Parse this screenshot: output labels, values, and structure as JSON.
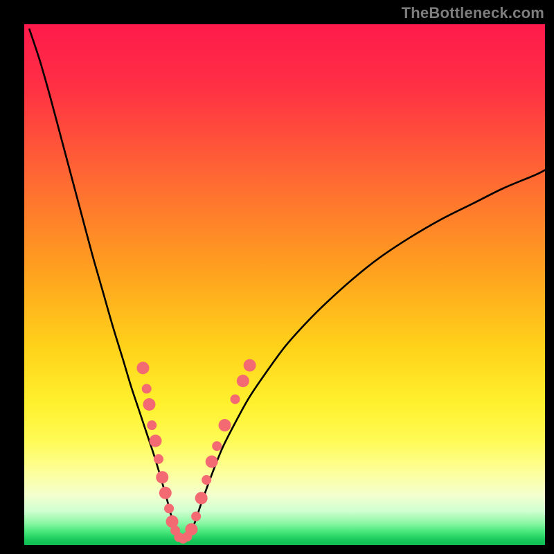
{
  "watermark": "TheBottleneck.com",
  "chart_data": {
    "type": "line",
    "title": "",
    "xlabel": "",
    "ylabel": "",
    "xlim": [
      0,
      100
    ],
    "ylim": [
      0,
      100
    ],
    "gradient_stops": [
      {
        "offset": 0.0,
        "color": "#ff1a4b"
      },
      {
        "offset": 0.12,
        "color": "#ff3044"
      },
      {
        "offset": 0.3,
        "color": "#ff6a32"
      },
      {
        "offset": 0.48,
        "color": "#ffa31e"
      },
      {
        "offset": 0.62,
        "color": "#ffd21a"
      },
      {
        "offset": 0.73,
        "color": "#fff12e"
      },
      {
        "offset": 0.8,
        "color": "#fffb55"
      },
      {
        "offset": 0.86,
        "color": "#fdff9a"
      },
      {
        "offset": 0.905,
        "color": "#f3ffcf"
      },
      {
        "offset": 0.935,
        "color": "#cfffd0"
      },
      {
        "offset": 0.958,
        "color": "#8bf7a4"
      },
      {
        "offset": 0.975,
        "color": "#46e77a"
      },
      {
        "offset": 0.99,
        "color": "#19c95b"
      },
      {
        "offset": 1.0,
        "color": "#0fbe52"
      }
    ],
    "series": [
      {
        "name": "bottleneck-curve",
        "x": [
          1,
          3,
          5,
          7,
          9,
          11,
          13,
          15,
          17,
          19,
          20.5,
          22,
          23.5,
          25,
          26.2,
          27.2,
          28,
          28.6,
          29.2,
          30,
          31,
          32,
          33,
          34,
          36,
          38,
          40,
          43,
          46,
          50,
          54,
          58,
          63,
          68,
          74,
          80,
          86,
          92,
          98,
          100
        ],
        "y": [
          99,
          93,
          86,
          78.5,
          71,
          63.5,
          56,
          49,
          42,
          35.5,
          30.5,
          26,
          21.5,
          17,
          13,
          9.5,
          6.5,
          4,
          2.3,
          1.2,
          1.2,
          2.5,
          5,
          8,
          13.5,
          18.5,
          22.5,
          28,
          32.5,
          38,
          42.5,
          46.5,
          51,
          55,
          59,
          62.5,
          65.5,
          68.5,
          71,
          72
        ]
      }
    ],
    "dots": {
      "name": "highlight-dots",
      "color": "#f46a72",
      "radius_small": 7,
      "radius_large": 9,
      "points": [
        {
          "x": 22.8,
          "y": 34.0,
          "r": "large"
        },
        {
          "x": 23.5,
          "y": 30.0,
          "r": "small"
        },
        {
          "x": 24.0,
          "y": 27.0,
          "r": "large"
        },
        {
          "x": 24.5,
          "y": 23.0,
          "r": "small"
        },
        {
          "x": 25.2,
          "y": 20.0,
          "r": "large"
        },
        {
          "x": 25.8,
          "y": 16.5,
          "r": "small"
        },
        {
          "x": 26.5,
          "y": 13.0,
          "r": "large"
        },
        {
          "x": 27.1,
          "y": 10.0,
          "r": "large"
        },
        {
          "x": 27.8,
          "y": 7.0,
          "r": "small"
        },
        {
          "x": 28.4,
          "y": 4.5,
          "r": "large"
        },
        {
          "x": 29.0,
          "y": 2.8,
          "r": "small"
        },
        {
          "x": 29.7,
          "y": 1.5,
          "r": "small"
        },
        {
          "x": 30.5,
          "y": 1.2,
          "r": "small"
        },
        {
          "x": 31.3,
          "y": 1.6,
          "r": "small"
        },
        {
          "x": 32.1,
          "y": 3.0,
          "r": "large"
        },
        {
          "x": 33.0,
          "y": 5.5,
          "r": "small"
        },
        {
          "x": 34.0,
          "y": 9.0,
          "r": "large"
        },
        {
          "x": 35.0,
          "y": 12.5,
          "r": "small"
        },
        {
          "x": 36.0,
          "y": 16.0,
          "r": "large"
        },
        {
          "x": 37.0,
          "y": 19.0,
          "r": "small"
        },
        {
          "x": 38.5,
          "y": 23.0,
          "r": "large"
        },
        {
          "x": 40.5,
          "y": 28.0,
          "r": "small"
        },
        {
          "x": 42.0,
          "y": 31.5,
          "r": "large"
        },
        {
          "x": 43.3,
          "y": 34.5,
          "r": "large"
        }
      ]
    }
  }
}
